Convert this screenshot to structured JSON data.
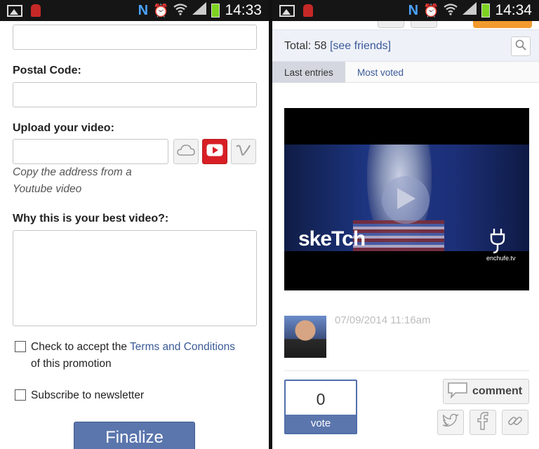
{
  "left_panel": {
    "status_bar": {
      "time": "14:33",
      "network_letter": "N"
    },
    "form": {
      "postal_code_label": "Postal Code:",
      "upload_label": "Upload your video:",
      "upload_hint_line1": "Copy the address from a",
      "upload_hint_line2": "Youtube video",
      "best_video_label": "Why this is your best video?:",
      "terms_prefix": "Check to accept the",
      "terms_link": "Terms and Conditions",
      "terms_suffix": "of this promotion",
      "newsletter_label": "Subscribe to newsletter",
      "finalize_label": "Finalize"
    }
  },
  "right_panel": {
    "status_bar": {
      "time": "14:34",
      "network_letter": "N"
    },
    "totals": {
      "label": "Total:",
      "count": "58",
      "friends_link": "[see friends]"
    },
    "tabs": [
      {
        "label": "Last entries",
        "active": true
      },
      {
        "label": "Most voted",
        "active": false
      }
    ],
    "video": {
      "title_logo": "skeTch",
      "brand": "enchufe.tv"
    },
    "entry": {
      "date": "07/09/2014 11:16am"
    },
    "vote": {
      "count": "0",
      "label": "vote"
    },
    "comment_label": "comment"
  },
  "colors": {
    "accent_blue": "#5b76ad",
    "link_blue": "#3b5998",
    "youtube_red": "#d81f26",
    "header_orange": "#f29a2e"
  },
  "icons": [
    "gallery-icon",
    "robot-icon",
    "nfc-icon",
    "alarm-icon",
    "wifi-icon",
    "signal-icon",
    "battery-icon",
    "cloud-icon",
    "youtube-icon",
    "vimeo-icon",
    "search-icon",
    "play-icon",
    "comment-icon",
    "twitter-icon",
    "facebook-icon",
    "link-icon"
  ]
}
